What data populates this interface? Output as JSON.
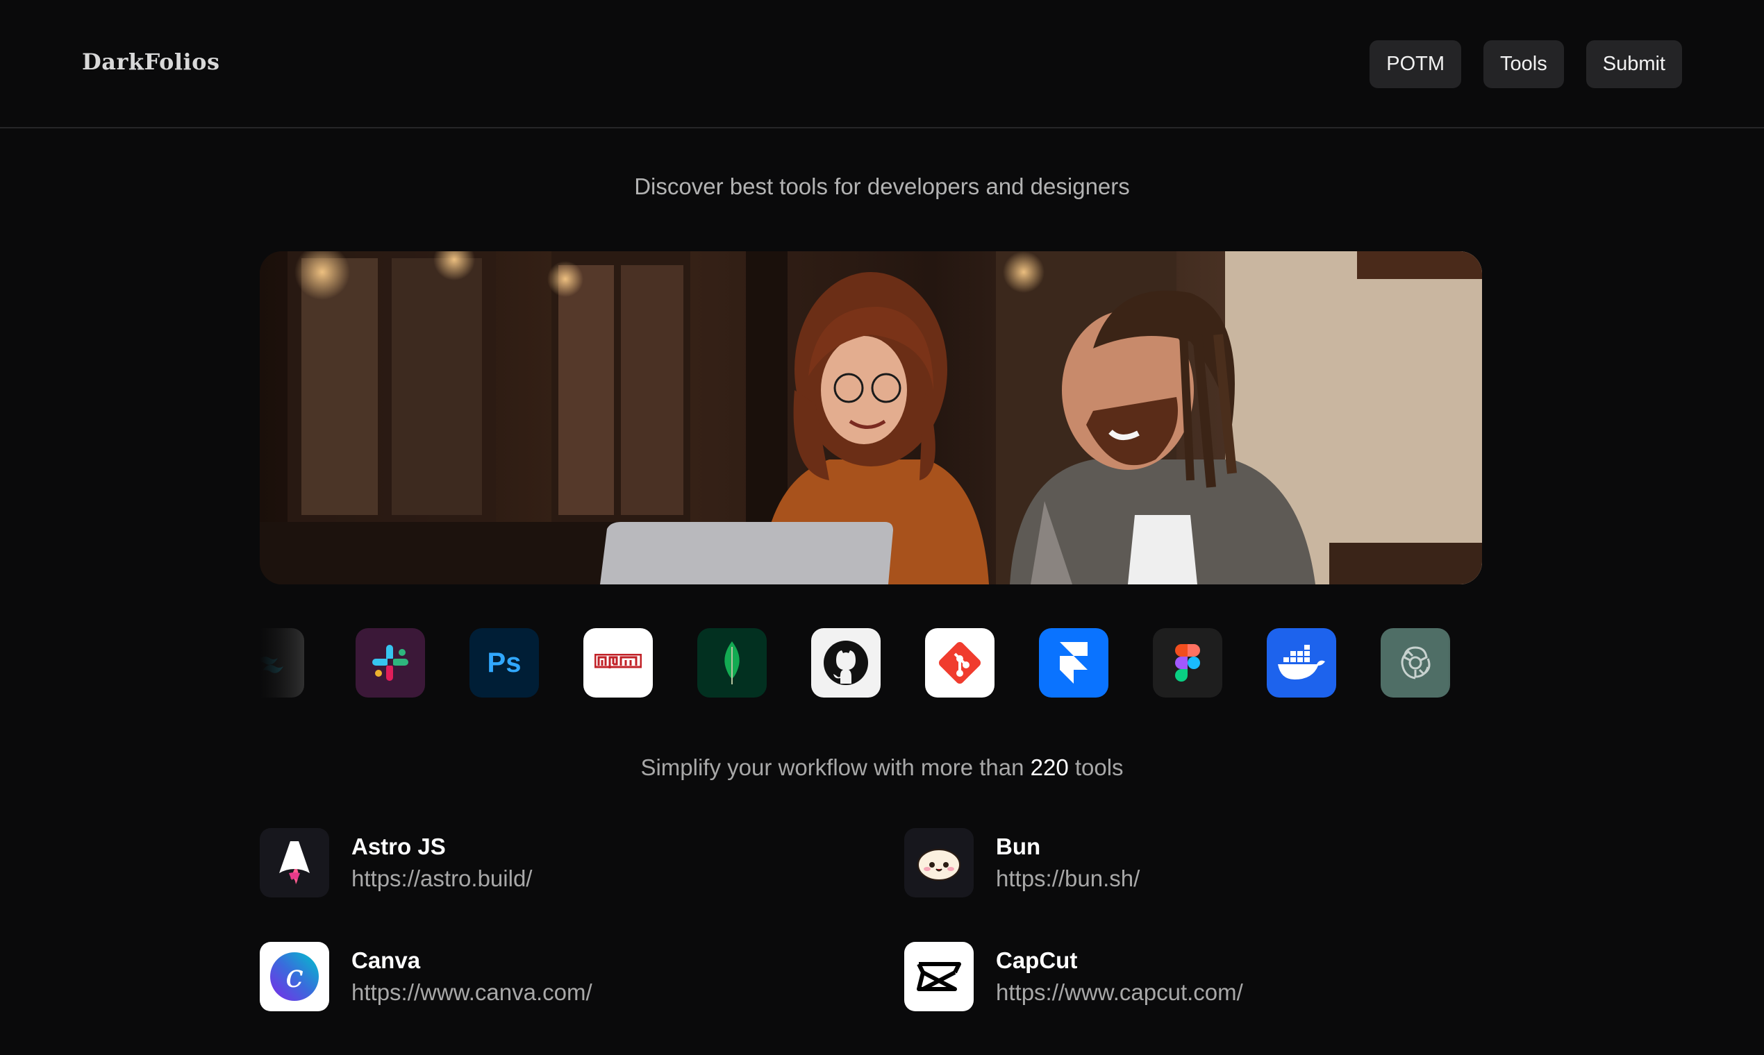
{
  "brand": {
    "name": "DarkFolios"
  },
  "nav": [
    {
      "label": "POTM"
    },
    {
      "label": "Tools"
    },
    {
      "label": "Submit"
    }
  ],
  "tagline": "Discover best tools for developers and designers",
  "strip": [
    {
      "name": "tailwind-icon",
      "glyph": "~",
      "bg": "#2a2a2c"
    },
    {
      "name": "slack-icon",
      "glyph": "",
      "bg": "#3b1838"
    },
    {
      "name": "photoshop-icon",
      "glyph": "Ps",
      "bg": "#001e36"
    },
    {
      "name": "npm-icon",
      "glyph": "npm",
      "bg": "#ffffff"
    },
    {
      "name": "mongodb-icon",
      "glyph": "",
      "bg": "#023020"
    },
    {
      "name": "github-icon",
      "glyph": "",
      "bg": "#f2f2f2"
    },
    {
      "name": "git-icon",
      "glyph": "",
      "bg": "#ffffff"
    },
    {
      "name": "framer-icon",
      "glyph": "",
      "bg": "#0a73ff"
    },
    {
      "name": "figma-icon",
      "glyph": "",
      "bg": "#1e1e1e"
    },
    {
      "name": "docker-icon",
      "glyph": "",
      "bg": "#1d63ed"
    },
    {
      "name": "openai-icon",
      "glyph": "",
      "bg": "#4f6e66"
    }
  ],
  "subtitle": {
    "prefix": "Simplify your workflow with more than ",
    "count": "220",
    "suffix": " tools"
  },
  "tools": [
    {
      "name": "Astro JS",
      "url": "https://astro.build/",
      "icon": "astro-icon"
    },
    {
      "name": "Bun",
      "url": "https://bun.sh/",
      "icon": "bun-icon"
    },
    {
      "name": "Canva",
      "url": "https://www.canva.com/",
      "icon": "canva-icon"
    },
    {
      "name": "CapCut",
      "url": "https://www.capcut.com/",
      "icon": "capcut-icon"
    }
  ]
}
